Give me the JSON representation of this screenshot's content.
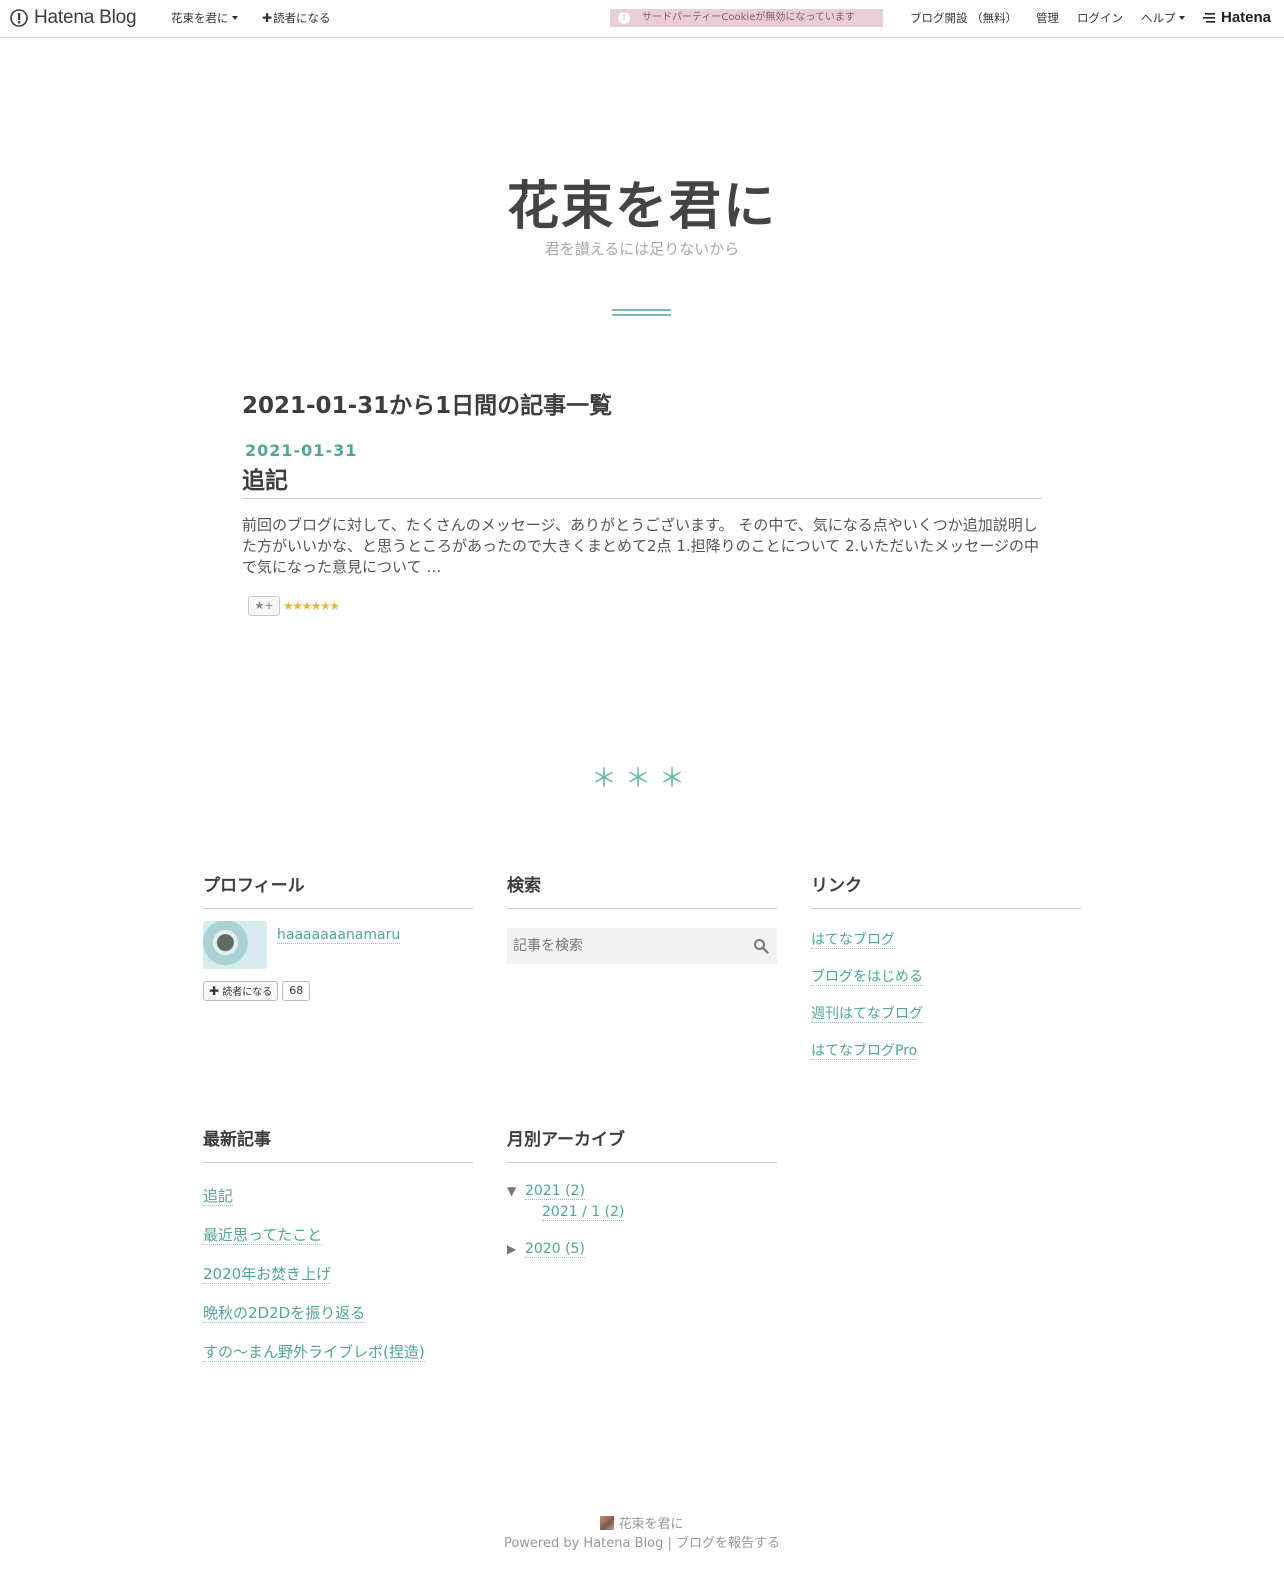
{
  "globalheader": {
    "logo_text": "Hatena Blog",
    "blog_menu": "花束を君に",
    "subscribe": "読者になる",
    "cookie_warning": "サードパーティーCookieが無効になっています",
    "open_blog": "ブログ開設 （無料）",
    "admin": "管理",
    "login": "ログイン",
    "help": "ヘルプ",
    "hatena": "Hatena"
  },
  "blog": {
    "title": "花束を君に",
    "description": "君を讃えるには足りないから"
  },
  "archive": {
    "heading": "2021-01-31から1日間の記事一覧",
    "entries": [
      {
        "date": "2021-01-31",
        "title": "追記",
        "summary": "前回のブログに対して、たくさんのメッセージ、ありがとうございます。 その中で、気になる点やいくつか追加説明した方がいいかな、と思うところがあったので大きくまとめて2点 1.担降りのことについて 2.いただいたメッセージの中で気になった意見について …",
        "star_add": "★+",
        "stars": "★★★★★★"
      }
    ],
    "separator": "＊＊＊"
  },
  "sidebar": {
    "profile": {
      "title": "プロフィール",
      "name": "haaaaaaanamaru",
      "subscribe_label": "読者になる",
      "subscriber_count": "68"
    },
    "search": {
      "title": "検索",
      "placeholder": "記事を検索"
    },
    "links": {
      "title": "リンク",
      "items": [
        "はてなブログ",
        "ブログをはじめる",
        "週刊はてなブログ",
        "はてなブログPro"
      ]
    },
    "recent": {
      "title": "最新記事",
      "items": [
        "追記",
        "最近思ってたこと",
        "2020年お焚き上げ",
        "晩秋の2D2Dを振り返る",
        "すの～まん野外ライブレポ(捏造)"
      ]
    },
    "archive": {
      "title": "月別アーカイブ",
      "year_2021": "2021 (2)",
      "month_2021_1": "2021 / 1 (2)",
      "year_2020": "2020 (5)",
      "expanded_marker": "▼",
      "collapsed_marker": "▶"
    }
  },
  "footer": {
    "blog_name": "花束を君に",
    "powered_by": "Powered by Hatena Blog",
    "separator": "|",
    "report": "ブログを報告する"
  },
  "colors": {
    "accent": "#4fa69b",
    "text": "#3d3d3d",
    "cookie_bg": "#e8cfd3"
  }
}
